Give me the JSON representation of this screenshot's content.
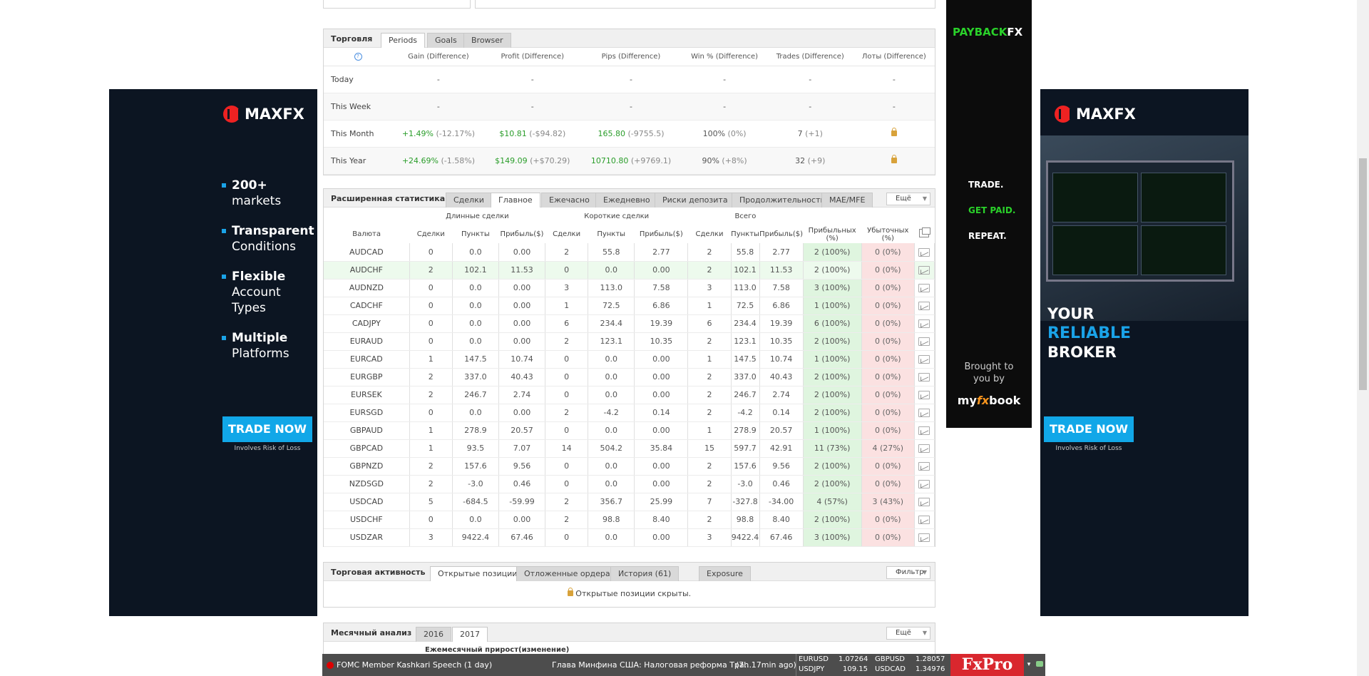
{
  "ad_left": {
    "brand": "MAXFX",
    "bullets": [
      {
        "strong": "200+",
        "rest": "markets"
      },
      {
        "strong": "Transparent",
        "rest": "Conditions"
      },
      {
        "strong": "Flexible",
        "rest": "Account Types"
      },
      {
        "strong": "Multiple",
        "rest": "Platforms"
      }
    ],
    "cta": "TRADE NOW",
    "risk": "Involves Risk of Loss"
  },
  "ad_right": {
    "brand": "MAXFX",
    "tagline1": "YOUR",
    "tagline2": "RELIABLE",
    "tagline3": "BROKER",
    "cta": "TRADE NOW",
    "risk": "Involves Risk of Loss"
  },
  "ad_payback": {
    "brand1": "PAYBACK",
    "brand2": "FX",
    "line1": "TRADE.",
    "line2": "GET PAID.",
    "line3": "REPEAT.",
    "brought": "Brought to you by",
    "mfb1": "my",
    "mfb2": "fx",
    "mfb3": "book"
  },
  "trading": {
    "title": "Торговля",
    "tabs": [
      "Periods",
      "Goals",
      "Browser"
    ],
    "headers": [
      "Gain (Difference)",
      "Profit (Difference)",
      "Pips (Difference)",
      "Win % (Difference)",
      "Trades (Difference)",
      "Лоты (Difference)"
    ],
    "rows": [
      {
        "label": "Today",
        "gain": "-",
        "gain_d": "",
        "profit": "-",
        "profit_d": "",
        "pips": "-",
        "pips_d": "",
        "win": "-",
        "win_d": "",
        "trades": "-",
        "trades_d": ""
      },
      {
        "label": "This Week",
        "gain": "-",
        "gain_d": "",
        "profit": "-",
        "profit_d": "",
        "pips": "-",
        "pips_d": "",
        "win": "-",
        "win_d": "",
        "trades": "-",
        "trades_d": ""
      },
      {
        "label": "This Month",
        "gain": "+1.49%",
        "gain_d": "(-12.17%)",
        "profit": "$10.81",
        "profit_d": "(-$94.82)",
        "pips": "165.80",
        "pips_d": "(-9755.5)",
        "win": "100%",
        "win_d": "(0%)",
        "trades": "7",
        "trades_d": "(+1)"
      },
      {
        "label": "This Year",
        "gain": "+24.69%",
        "gain_d": "(-1.58%)",
        "profit": "$149.09",
        "profit_d": "(+$70.29)",
        "pips": "10710.80",
        "pips_d": "(+9769.1)",
        "win": "90%",
        "win_d": "(+8%)",
        "trades": "32",
        "trades_d": "(+9)"
      }
    ]
  },
  "advanced": {
    "title": "Расширенная статистика",
    "tabs": [
      "Сделки",
      "Главное",
      "Ежечасно",
      "Ежедневно",
      "Риски депозита",
      "Продолжительность",
      "MAE/MFE"
    ],
    "more": "Ещё",
    "groups": [
      "Длинные сделки",
      "Короткие сделки",
      "Всего"
    ],
    "headers": [
      "Валюта",
      "Сделки",
      "Пункты",
      "Прибыль($)",
      "Сделки",
      "Пункты",
      "Прибыль($)",
      "Сделки",
      "Пункты",
      "Прибыль($)",
      "Прибыльных (%)",
      "Убыточных (%)"
    ],
    "rows": [
      [
        "AUDCAD",
        "0",
        "0.0",
        "0.00",
        "2",
        "55.8",
        "2.77",
        "2",
        "55.8",
        "2.77",
        "2 (100%)",
        "0 (0%)"
      ],
      [
        "AUDCHF",
        "2",
        "102.1",
        "11.53",
        "0",
        "0.0",
        "0.00",
        "2",
        "102.1",
        "11.53",
        "2 (100%)",
        "0 (0%)"
      ],
      [
        "AUDNZD",
        "0",
        "0.0",
        "0.00",
        "3",
        "113.0",
        "7.58",
        "3",
        "113.0",
        "7.58",
        "3 (100%)",
        "0 (0%)"
      ],
      [
        "CADCHF",
        "0",
        "0.0",
        "0.00",
        "1",
        "72.5",
        "6.86",
        "1",
        "72.5",
        "6.86",
        "1 (100%)",
        "0 (0%)"
      ],
      [
        "CADJPY",
        "0",
        "0.0",
        "0.00",
        "6",
        "234.4",
        "19.39",
        "6",
        "234.4",
        "19.39",
        "6 (100%)",
        "0 (0%)"
      ],
      [
        "EURAUD",
        "0",
        "0.0",
        "0.00",
        "2",
        "123.1",
        "10.35",
        "2",
        "123.1",
        "10.35",
        "2 (100%)",
        "0 (0%)"
      ],
      [
        "EURCAD",
        "1",
        "147.5",
        "10.74",
        "0",
        "0.0",
        "0.00",
        "1",
        "147.5",
        "10.74",
        "1 (100%)",
        "0 (0%)"
      ],
      [
        "EURGBP",
        "2",
        "337.0",
        "40.43",
        "0",
        "0.0",
        "0.00",
        "2",
        "337.0",
        "40.43",
        "2 (100%)",
        "0 (0%)"
      ],
      [
        "EURSEK",
        "2",
        "246.7",
        "2.74",
        "0",
        "0.0",
        "0.00",
        "2",
        "246.7",
        "2.74",
        "2 (100%)",
        "0 (0%)"
      ],
      [
        "EURSGD",
        "0",
        "0.0",
        "0.00",
        "2",
        "-4.2",
        "0.14",
        "2",
        "-4.2",
        "0.14",
        "2 (100%)",
        "0 (0%)"
      ],
      [
        "GBPAUD",
        "1",
        "278.9",
        "20.57",
        "0",
        "0.0",
        "0.00",
        "1",
        "278.9",
        "20.57",
        "1 (100%)",
        "0 (0%)"
      ],
      [
        "GBPCAD",
        "1",
        "93.5",
        "7.07",
        "14",
        "504.2",
        "35.84",
        "15",
        "597.7",
        "42.91",
        "11 (73%)",
        "4 (27%)"
      ],
      [
        "GBPNZD",
        "2",
        "157.6",
        "9.56",
        "0",
        "0.0",
        "0.00",
        "2",
        "157.6",
        "9.56",
        "2 (100%)",
        "0 (0%)"
      ],
      [
        "NZDSGD",
        "2",
        "-3.0",
        "0.46",
        "0",
        "0.0",
        "0.00",
        "2",
        "-3.0",
        "0.46",
        "2 (100%)",
        "0 (0%)"
      ],
      [
        "USDCAD",
        "5",
        "-684.5",
        "-59.99",
        "2",
        "356.7",
        "25.99",
        "7",
        "-327.8",
        "-34.00",
        "4 (57%)",
        "3 (43%)"
      ],
      [
        "USDCHF",
        "0",
        "0.0",
        "0.00",
        "2",
        "98.8",
        "8.40",
        "2",
        "98.8",
        "8.40",
        "2 (100%)",
        "0 (0%)"
      ],
      [
        "USDZAR",
        "3",
        "9422.4",
        "67.46",
        "0",
        "0.0",
        "0.00",
        "3",
        "9422.4",
        "67.46",
        "3 (100%)",
        "0 (0%)"
      ]
    ]
  },
  "activity": {
    "title": "Торговая активность",
    "tabs": [
      "Открытые позиции",
      "Отложенные ордера",
      "История (61)",
      "Exposure"
    ],
    "filter": "Фильтр",
    "hidden": "Открытые позиции скрыты."
  },
  "monthly": {
    "title": "Месячный анализ",
    "tabs": [
      "2016",
      "2017"
    ],
    "more": "Ещё",
    "subtitle": "Ежемесячный прирост(изменение)"
  },
  "ticker": {
    "event": "FOMC Member Kashkari Speech (1 day)",
    "news": "Глава Минфина США: Налоговая реформа Тра...",
    "ago": "(7h 17min ago)",
    "quotes": [
      {
        "sym": "EURUSD",
        "val": "1.07264"
      },
      {
        "sym": "GBPUSD",
        "val": "1.28057"
      },
      {
        "sym": "USDJPY",
        "val": "109.15"
      },
      {
        "sym": "USDCAD",
        "val": "1.34976"
      }
    ],
    "broker": "FxPro"
  }
}
